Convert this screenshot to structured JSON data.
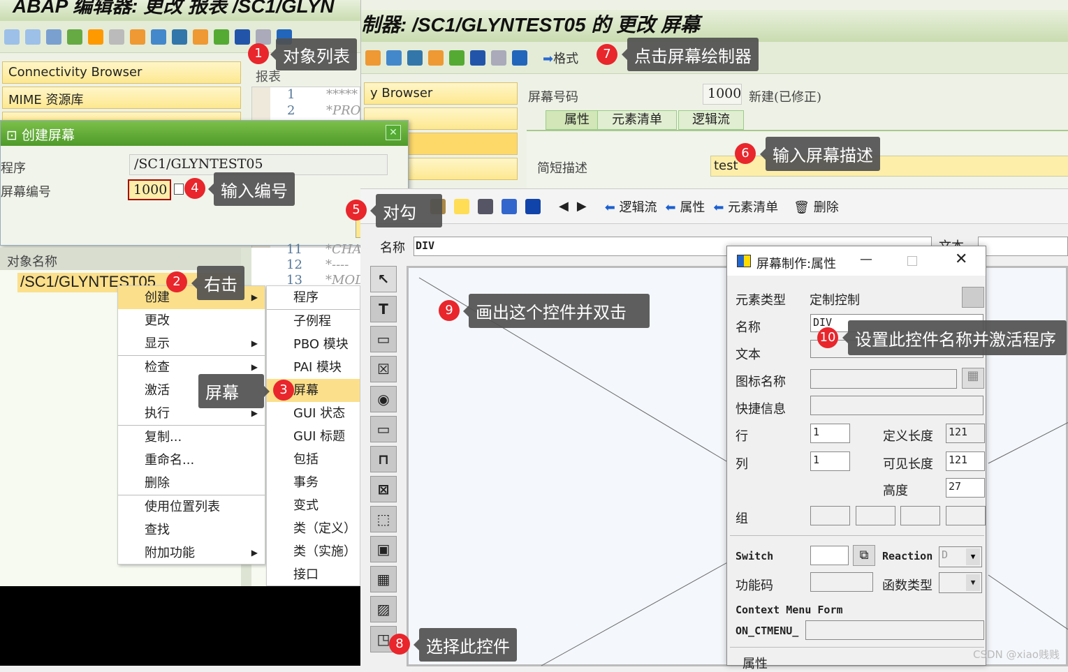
{
  "editor": {
    "title": "ABAP 编辑器:  更改 报表 /SC1/GLYN",
    "buttons": [
      "Connectivity Browser",
      "MIME 资源库"
    ],
    "report_label": "报表",
    "code_lines": [
      {
        "n": "1",
        "t": "*****"
      },
      {
        "n": "2",
        "t": "*PROC"
      },
      {
        "n": "11",
        "t": "*CHAI"
      },
      {
        "n": "12",
        "t": "*----"
      },
      {
        "n": "13",
        "t": "*MOD."
      }
    ]
  },
  "painter_header": {
    "title": "制器:  /SC1/GLYNTEST05 的 更改 屏幕",
    "format_label": "格式",
    "button_partial": "y Browser",
    "screen_no_label": "屏幕号码",
    "screen_no": "1000",
    "status": "新建(已修正)",
    "tabs": [
      "属性",
      "元素清单",
      "逻辑流"
    ],
    "desc_label": "简短描述",
    "desc_value": "test"
  },
  "create_dialog": {
    "title": "创建屏幕",
    "program_label": "程序",
    "program_value": "/SC1/GLYNTEST05",
    "screen_label": "屏幕编号",
    "screen_value": "1000"
  },
  "tree": {
    "header": "对象名称",
    "item": "/SC1/GLYNTEST05"
  },
  "context_menu": {
    "items": [
      "创建",
      "更改",
      "显示",
      "检查",
      "激活",
      "执行",
      "复制...",
      "重命名...",
      "删除",
      "使用位置列表",
      "查找",
      "附加功能"
    ],
    "submenu": [
      "程序",
      "子例程",
      "PBO 模块",
      "PAI 模块",
      "屏幕",
      "GUI 状态",
      "GUI 标题",
      "包括",
      "事务",
      "变式",
      "类（定义）",
      "类（实施）",
      "接口"
    ]
  },
  "painter": {
    "toolbar": [
      "逻辑流",
      "属性",
      "元素清单",
      "删除"
    ],
    "name_label": "名称",
    "name_value": "DIV",
    "text_label": "文本"
  },
  "props": {
    "title": "屏幕制作:属性",
    "labels": {
      "type": "元素类型",
      "name": "名称",
      "text": "文本",
      "icon": "图标名称",
      "quick": "快捷信息",
      "row": "行",
      "col": "列",
      "deflen": "定义长度",
      "vislen": "可见长度",
      "height": "高度",
      "group": "组",
      "switch": "Switch",
      "reaction": "Reaction",
      "fcode": "功能码",
      "ftype": "函数类型",
      "ctx": "Context Menu Form",
      "ctxprefix": "ON_CTMENU_",
      "section": "属性"
    },
    "values": {
      "type": "定制控制",
      "name": "DIV",
      "row": "1",
      "col": "1",
      "deflen": "121",
      "vislen": "121",
      "height": "27",
      "reaction": "D"
    }
  },
  "callouts": [
    {
      "n": "1",
      "t": "对象列表"
    },
    {
      "n": "2",
      "t": "右击"
    },
    {
      "n": "3",
      "t": "屏幕"
    },
    {
      "n": "4",
      "t": "输入编号"
    },
    {
      "n": "5",
      "t": "对勾"
    },
    {
      "n": "6",
      "t": "输入屏幕描述"
    },
    {
      "n": "7",
      "t": "点击屏幕绘制器"
    },
    {
      "n": "8",
      "t": "选择此控件"
    },
    {
      "n": "9",
      "t": "画出这个控件并双击"
    },
    {
      "n": "10",
      "t": "设置此控件名称并激活程序"
    }
  ],
  "watermark": "CSDN @xiao贱贱"
}
